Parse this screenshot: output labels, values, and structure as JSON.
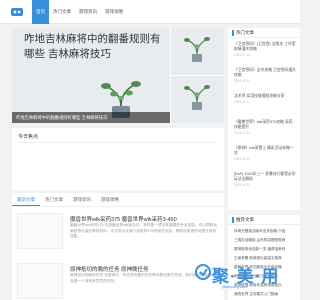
{
  "header": {
    "nav": [
      "首页",
      "热门文章",
      "游戏资讯",
      "游戏攻略"
    ],
    "active_index": 0
  },
  "hero": {
    "title": "咋地吉林麻将中的翻番规则有哪些  吉林麻将技巧",
    "caption": "咋地吉林麻将中的翻番规则有哪些 吉林麻将技巧"
  },
  "today": {
    "title": "今日焦点"
  },
  "tabs": [
    "最新文章",
    "热门文章",
    "游戏资讯",
    "游戏攻略"
  ],
  "articles": [
    {
      "title": "魔兽世界wlk采药375 魔兽世界wlk采药3-450",
      "desc": "魔兽世界wlk采药375 在魔兽世界wlk版本中，采药是一项非常重要的专业技能，可以帮助玩家获得大量的草药材料。本文将为大家介绍采药375的相关内容，帮助玩家更好地提升采药技能。"
    },
    {
      "title": "原神抵切的晚的任务 原神晚任务",
      "desc": "原神抵切的晚的任务 在原神中，有许多有趣的任务等待着玩家去完成，其中抵切的晚的任务是一个非常有意思的任务。"
    }
  ],
  "hot": {
    "title": "热门文章",
    "items": [
      {
        "title": "《卫宫密码》(卫宫宫) 全版本 工作室剧情通关攻略",
        "date": "2024-07-11"
      },
      {
        "title": "《卫宫密码》全关攻略 卫宫密码通关攻略",
        "date": "2024-07-11"
      },
      {
        "title": "法术师 实用技能搭配攻略分享",
        "date": "2024-07-11"
      },
      {
        "title": "《魔兽世界》wlk采药375攻略 采药技能提升",
        "date": "2024-07-11"
      },
      {
        "title": "《原神》wlk采雪上 精彩活动攻略一览",
        "date": "2024-07-11"
      },
      {
        "title": "[DnF] 2024年三一 家暴技巧都是必学玩法全解析",
        "date": "2024-07-11"
      }
    ]
  },
  "recommend": {
    "title": "推荐文章",
    "items": [
      "传奇无限挑战版本全关攻略 介绍",
      "三国志战略版 吕布阵容搭配推荐",
      "原神新角色技能一览 值得培养吗",
      "王者荣耀 新英雄出装铭文推荐",
      "魔兽世界 怀旧服新手升级攻略",
      "和平精英 上分技巧全面解析",
      "英雄联盟 新版本强势英雄盘点",
      "我的世界 生存模式入门指南"
    ]
  },
  "watermark": {
    "text": "聚·美·用",
    "sub": "jimeiyong.com"
  },
  "colors": {
    "accent": "#3a8fdc"
  }
}
